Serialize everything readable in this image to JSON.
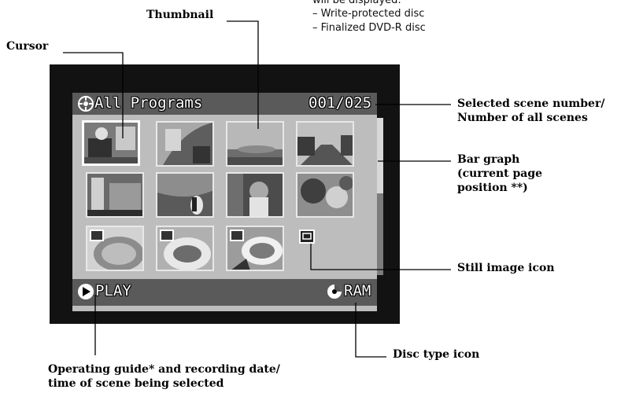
{
  "notes": {
    "line1": "will be displayed:",
    "line2": "– Write-protected disc",
    "line3": "– Finalized DVD-R disc"
  },
  "labels": {
    "thumbnail": "Thumbnail",
    "cursor": "Cursor",
    "selected_scene": "Selected scene number/",
    "all_scenes": "Number of all scenes",
    "bar_graph_1": "Bar graph",
    "bar_graph_2": "(current page",
    "bar_graph_3": "position **)",
    "still_icon": "Still image icon",
    "disc_type": "Disc type icon",
    "guide_1": "Operating guide* and recording date/",
    "guide_2": "time of scene being selected"
  },
  "screen": {
    "title": "All Programs",
    "counter": "001/025",
    "play": "PLAY",
    "disc": "RAM"
  },
  "scrollbar": {
    "position_fraction": 0.0,
    "visible_fraction": 0.48
  },
  "thumbnails": [
    {
      "row": 1,
      "col": 1,
      "kind": "video",
      "selected": true
    },
    {
      "row": 1,
      "col": 2,
      "kind": "video"
    },
    {
      "row": 1,
      "col": 3,
      "kind": "video"
    },
    {
      "row": 1,
      "col": 4,
      "kind": "video"
    },
    {
      "row": 2,
      "col": 1,
      "kind": "video"
    },
    {
      "row": 2,
      "col": 2,
      "kind": "video"
    },
    {
      "row": 2,
      "col": 3,
      "kind": "video"
    },
    {
      "row": 2,
      "col": 4,
      "kind": "video"
    },
    {
      "row": 3,
      "col": 1,
      "kind": "still"
    },
    {
      "row": 3,
      "col": 2,
      "kind": "still"
    },
    {
      "row": 3,
      "col": 3,
      "kind": "still"
    },
    {
      "row": 3,
      "col": 4,
      "kind": "empty"
    }
  ]
}
